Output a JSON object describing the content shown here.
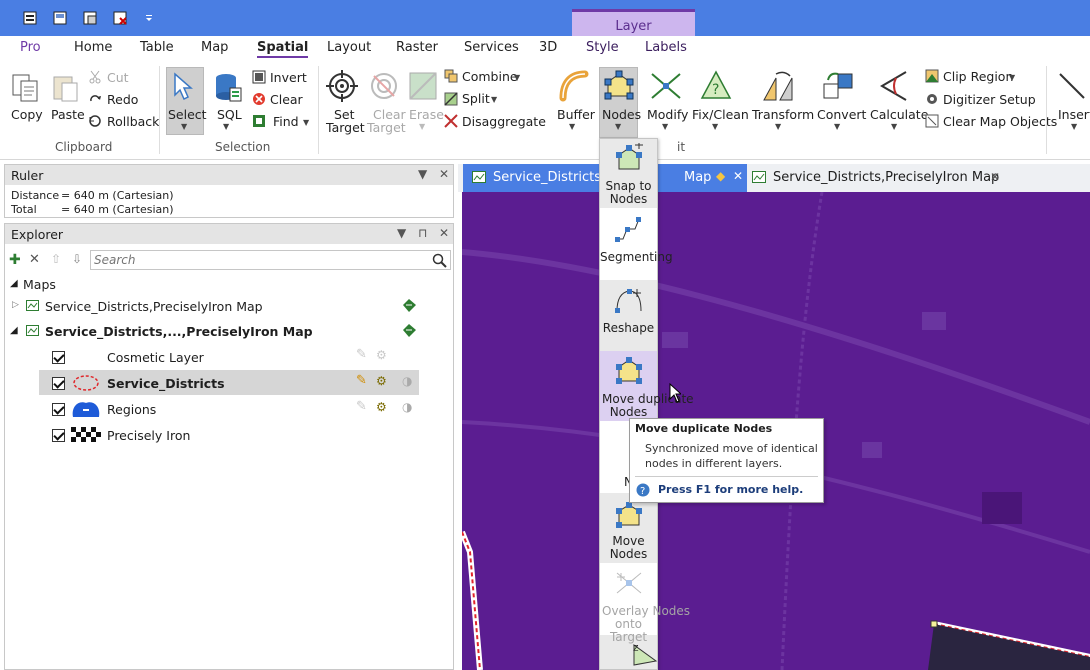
{
  "titlebar": {
    "context_group": "Layer"
  },
  "tabs": [
    "Pro",
    "Home",
    "Table",
    "Map",
    "Spatial",
    "Layout",
    "Raster",
    "Services",
    "3D",
    "Style",
    "Labels"
  ],
  "ribbon": {
    "clipboard": {
      "copy": "Copy",
      "paste": "Paste",
      "cut": "Cut",
      "redo": "Redo",
      "rollback": "Rollback",
      "group": "Clipboard"
    },
    "selection": {
      "select": "Select",
      "sql": "SQL",
      "invert": "Invert",
      "clear": "Clear",
      "find": "Find",
      "group": "Selection"
    },
    "edit": {
      "set_target_1": "Set",
      "set_target_2": "Target",
      "clear_target_1": "Clear",
      "clear_target_2": "Target",
      "erase": "Erase",
      "combine": "Combine",
      "split": "Split",
      "disaggregate": "Disaggregate",
      "buffer": "Buffer",
      "nodes": "Nodes",
      "modify": "Modify",
      "fix_clean": "Fix/Clean",
      "transform": "Transform",
      "convert": "Convert",
      "calculate": "Calculate",
      "clip_region": "Clip Region",
      "digitizer_setup": "Digitizer Setup",
      "clear_map_objects": "Clear Map Objects",
      "insert": "Insert",
      "group_partial": "it"
    }
  },
  "ruler": {
    "title": "Ruler",
    "distance_label": "Distance",
    "distance_value": "= 640 m (Cartesian)",
    "total_label": "Total",
    "total_value": "= 640 m (Cartesian)"
  },
  "explorer": {
    "title": "Explorer",
    "search_placeholder": "Search",
    "maps_label": "Maps",
    "map1": "Service_Districts,PreciselyIron Map",
    "map2": "Service_Districts,...,PreciselyIron Map",
    "layers": [
      "Cosmetic Layer",
      "Service_Districts",
      "Regions",
      "Precisely Iron"
    ]
  },
  "doc_tabs": {
    "tab1": "Service_Districts,...,",
    "tab1_tail": "Map",
    "tab2": "Service_Districts,PreciselyIron Map"
  },
  "nodes_menu": {
    "snap_1": "Snap to",
    "snap_2": "Nodes",
    "segmenting": "Segmenting",
    "reshape": "Reshape",
    "move_dup_1": "Move duplicate",
    "move_dup_2": "Nodes",
    "hidden_partial": "N",
    "move_1": "Move",
    "move_2": "Nodes",
    "overlay_1": "Overlay Nodes",
    "overlay_2": "onto Target"
  },
  "tooltip": {
    "title": "Move duplicate Nodes",
    "body_1": "Synchronized move of identical",
    "body_2": "nodes in different layers.",
    "help": "Press F1 for more help."
  },
  "colors": {
    "titlebar": "#4a7ee3",
    "context": "#cdb6ee",
    "accent": "#6f3aa6",
    "map_bg": "#5b1d91",
    "active_doc_tab": "#4a7ee3"
  }
}
